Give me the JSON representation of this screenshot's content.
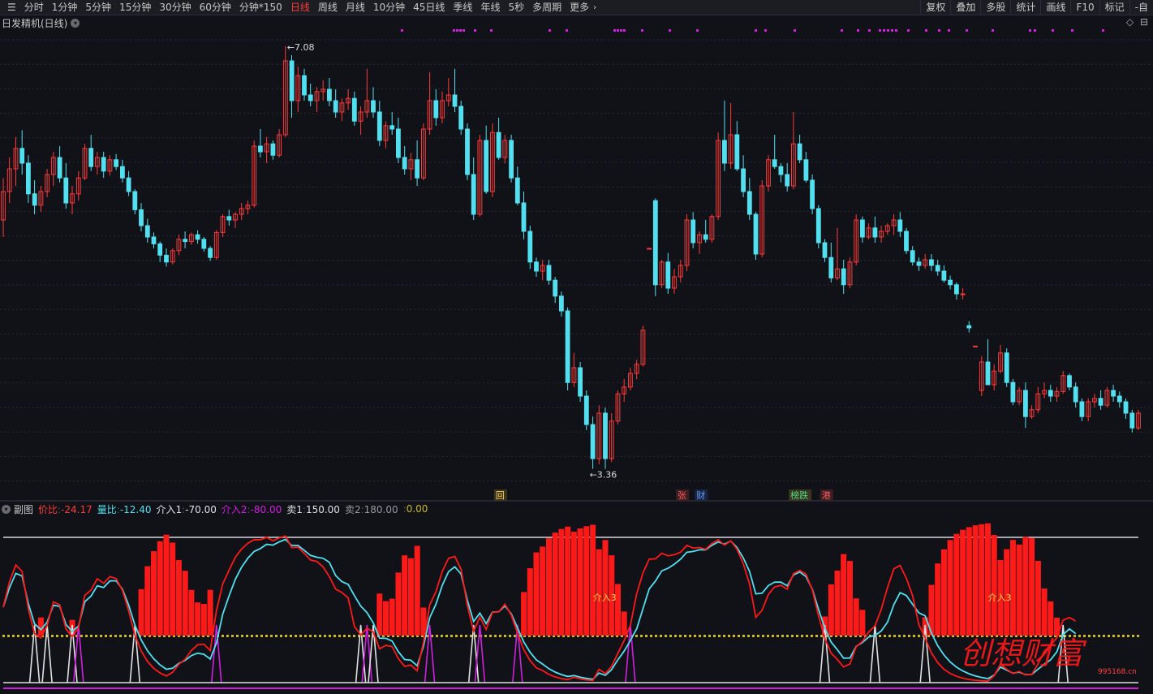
{
  "toolbar": {
    "menu_icon": "☰",
    "period_tabs": [
      {
        "label": "分时",
        "active": false
      },
      {
        "label": "1分钟",
        "active": false
      },
      {
        "label": "5分钟",
        "active": false
      },
      {
        "label": "15分钟",
        "active": false
      },
      {
        "label": "30分钟",
        "active": false
      },
      {
        "label": "60分钟",
        "active": false
      },
      {
        "label": "分钟*150",
        "active": false
      },
      {
        "label": "日线",
        "active": true
      },
      {
        "label": "周线",
        "active": false
      },
      {
        "label": "月线",
        "active": false
      },
      {
        "label": "10分钟",
        "active": false
      },
      {
        "label": "45日线",
        "active": false
      },
      {
        "label": "季线",
        "active": false
      },
      {
        "label": "年线",
        "active": false
      },
      {
        "label": "5秒",
        "active": false
      },
      {
        "label": "多周期",
        "active": false
      },
      {
        "label": "更多",
        "active": false
      }
    ],
    "more_arrow": "›",
    "right_buttons": [
      "复权",
      "叠加",
      "多股",
      "统计",
      "画线",
      "F10",
      "标记",
      "-自"
    ]
  },
  "main_chart": {
    "title": "日发精机(日线)",
    "high_label": "7.08",
    "low_label": "3.36",
    "arrow_glyph": "←",
    "top_right_icons": [
      "◇",
      "⊟"
    ],
    "event_markers": [
      {
        "text": "回",
        "color": "#ffd24a",
        "bg": "#3a3320",
        "after_bar": 78
      },
      {
        "text": "张",
        "color": "#ff5b5b",
        "bg": "#3a1e22",
        "after_bar": 107
      },
      {
        "text": "财",
        "color": "#5aa0ff",
        "bg": "#1c2440",
        "after_bar": 110
      },
      {
        "text": "榜跌",
        "color": "#4ade80",
        "bg": "#3a3320",
        "after_bar": 125
      },
      {
        "text": "港",
        "color": "#ff5b5b",
        "bg": "#3a1e22",
        "after_bar": 130
      }
    ],
    "colors": {
      "up": "#ff3b3b",
      "down": "#52e0f0",
      "grid": "#2a2b33",
      "dot": "#d020e0"
    }
  },
  "sub_chart": {
    "name": "副图",
    "legend": [
      {
        "label": "价比",
        "value": "-24.17",
        "color": "#ff3b3b"
      },
      {
        "label": "量比",
        "value": "-12.40",
        "color": "#52e0f0"
      },
      {
        "label": "介入1",
        "value": "-70.00",
        "color": "#e0e0e0"
      },
      {
        "label": "介入2",
        "value": "-80.00",
        "color": "#d020e0"
      },
      {
        "label": "卖1",
        "value": "150.00",
        "color": "#e0e0e0"
      },
      {
        "label": "卖2",
        "value": "180.00",
        "color": "#9a9a9a"
      },
      {
        "label": "",
        "value": "0.00",
        "color": "#c8b830"
      }
    ],
    "signal_labels": [
      "介入3",
      "介入3"
    ],
    "watermark_brand": "创想财富",
    "watermark_url": "995168.cn"
  },
  "chart_data": {
    "type": "candlestick",
    "y_range": [
      3.2,
      7.2
    ],
    "candles": [
      [
        5.55,
        5.92,
        5.4,
        5.8
      ],
      [
        5.8,
        6.1,
        5.7,
        6.0
      ],
      [
        6.0,
        6.28,
        5.85,
        6.18
      ],
      [
        6.18,
        6.34,
        5.95,
        6.05
      ],
      [
        6.05,
        6.12,
        5.7,
        5.78
      ],
      [
        5.78,
        5.9,
        5.6,
        5.68
      ],
      [
        5.68,
        5.85,
        5.62,
        5.8
      ],
      [
        5.8,
        6.0,
        5.75,
        5.95
      ],
      [
        5.95,
        6.15,
        5.85,
        6.1
      ],
      [
        6.1,
        6.2,
        5.88,
        5.92
      ],
      [
        5.92,
        6.05,
        5.65,
        5.7
      ],
      [
        5.7,
        5.85,
        5.6,
        5.78
      ],
      [
        5.78,
        5.98,
        5.72,
        5.92
      ],
      [
        5.92,
        6.22,
        5.9,
        6.18
      ],
      [
        6.18,
        6.3,
        5.98,
        6.02
      ],
      [
        6.02,
        6.15,
        5.95,
        6.1
      ],
      [
        6.1,
        6.15,
        5.92,
        5.98
      ],
      [
        5.98,
        6.12,
        5.94,
        6.08
      ],
      [
        6.08,
        6.13,
        5.99,
        6.02
      ],
      [
        6.02,
        6.08,
        5.88,
        5.92
      ],
      [
        5.92,
        5.98,
        5.76,
        5.8
      ],
      [
        5.8,
        5.82,
        5.6,
        5.64
      ],
      [
        5.64,
        5.7,
        5.45,
        5.5
      ],
      [
        5.5,
        5.56,
        5.35,
        5.4
      ],
      [
        5.4,
        5.44,
        5.3,
        5.34
      ],
      [
        5.34,
        5.36,
        5.18,
        5.24
      ],
      [
        5.24,
        5.3,
        5.14,
        5.18
      ],
      [
        5.18,
        5.3,
        5.16,
        5.28
      ],
      [
        5.28,
        5.42,
        5.24,
        5.38
      ],
      [
        5.38,
        5.45,
        5.3,
        5.36
      ],
      [
        5.36,
        5.44,
        5.33,
        5.42
      ],
      [
        5.42,
        5.46,
        5.34,
        5.38
      ],
      [
        5.38,
        5.4,
        5.27,
        5.3
      ],
      [
        5.3,
        5.32,
        5.19,
        5.22
      ],
      [
        5.22,
        5.46,
        5.2,
        5.44
      ],
      [
        5.44,
        5.6,
        5.4,
        5.58
      ],
      [
        5.58,
        5.64,
        5.5,
        5.55
      ],
      [
        5.55,
        5.62,
        5.48,
        5.6
      ],
      [
        5.6,
        5.7,
        5.55,
        5.65
      ],
      [
        5.65,
        5.72,
        5.6,
        5.68
      ],
      [
        5.68,
        6.25,
        5.66,
        6.2
      ],
      [
        6.2,
        6.35,
        6.1,
        6.15
      ],
      [
        6.15,
        6.28,
        6.05,
        6.22
      ],
      [
        6.22,
        6.25,
        6.08,
        6.12
      ],
      [
        6.12,
        6.35,
        6.1,
        6.3
      ],
      [
        6.3,
        7.08,
        6.28,
        6.95
      ],
      [
        6.95,
        7.0,
        6.45,
        6.6
      ],
      [
        6.6,
        6.9,
        6.5,
        6.82
      ],
      [
        6.82,
        6.88,
        6.6,
        6.65
      ],
      [
        6.65,
        6.75,
        6.55,
        6.6
      ],
      [
        6.6,
        6.72,
        6.5,
        6.68
      ],
      [
        6.68,
        6.78,
        6.6,
        6.7
      ],
      [
        6.7,
        6.8,
        6.55,
        6.6
      ],
      [
        6.6,
        6.7,
        6.45,
        6.5
      ],
      [
        6.5,
        6.62,
        6.42,
        6.58
      ],
      [
        6.58,
        6.7,
        6.52,
        6.62
      ],
      [
        6.62,
        6.68,
        6.38,
        6.42
      ],
      [
        6.42,
        6.55,
        6.3,
        6.5
      ],
      [
        6.5,
        6.88,
        6.45,
        6.6
      ],
      [
        6.6,
        6.72,
        6.45,
        6.5
      ],
      [
        6.5,
        6.6,
        6.2,
        6.25
      ],
      [
        6.25,
        6.42,
        6.18,
        6.38
      ],
      [
        6.38,
        6.5,
        6.3,
        6.35
      ],
      [
        6.35,
        6.45,
        6.05,
        6.1
      ],
      [
        6.1,
        6.2,
        5.95,
        6.0
      ],
      [
        6.0,
        6.14,
        5.9,
        6.08
      ],
      [
        6.08,
        6.25,
        5.85,
        5.92
      ],
      [
        5.92,
        6.4,
        5.9,
        6.35
      ],
      [
        6.35,
        6.85,
        6.3,
        6.6
      ],
      [
        6.6,
        6.7,
        6.38,
        6.45
      ],
      [
        6.45,
        6.68,
        6.4,
        6.6
      ],
      [
        6.6,
        6.8,
        6.55,
        6.65
      ],
      [
        6.65,
        6.88,
        6.5,
        6.55
      ],
      [
        6.55,
        6.6,
        6.3,
        6.35
      ],
      [
        6.35,
        6.4,
        5.9,
        5.95
      ],
      [
        5.95,
        6.1,
        5.55,
        5.6
      ],
      [
        5.6,
        6.3,
        5.58,
        6.25
      ],
      [
        6.25,
        6.38,
        5.78,
        5.8
      ],
      [
        5.8,
        6.4,
        5.75,
        6.32
      ],
      [
        6.32,
        6.45,
        6.08,
        6.1
      ],
      [
        6.1,
        6.3,
        6.05,
        6.25
      ],
      [
        6.25,
        6.3,
        5.88,
        5.92
      ],
      [
        5.92,
        6.02,
        5.68,
        5.7
      ],
      [
        5.7,
        5.8,
        5.38,
        5.45
      ],
      [
        5.45,
        5.5,
        5.12,
        5.18
      ],
      [
        5.18,
        5.22,
        5.05,
        5.1
      ],
      [
        5.1,
        5.2,
        5.02,
        5.15
      ],
      [
        5.15,
        5.2,
        4.98,
        5.02
      ],
      [
        5.02,
        5.05,
        4.82,
        4.88
      ],
      [
        4.88,
        4.92,
        4.7,
        4.75
      ],
      [
        4.75,
        4.78,
        4.05,
        4.12
      ],
      [
        4.12,
        4.38,
        4.08,
        4.25
      ],
      [
        4.25,
        4.3,
        3.95,
        4.0
      ],
      [
        4.0,
        4.05,
        3.7,
        3.75
      ],
      [
        3.75,
        3.82,
        3.36,
        3.45
      ],
      [
        3.45,
        3.92,
        3.4,
        3.85
      ],
      [
        3.85,
        3.9,
        3.36,
        3.45
      ],
      [
        3.45,
        3.85,
        3.42,
        3.78
      ],
      [
        3.78,
        4.05,
        3.75,
        4.02
      ],
      [
        4.02,
        4.15,
        3.95,
        4.08
      ],
      [
        4.08,
        4.25,
        4.05,
        4.2
      ],
      [
        4.2,
        4.32,
        4.15,
        4.28
      ],
      [
        4.28,
        4.62,
        4.26,
        4.58
      ],
      [
        5.3,
        5.3,
        5.3,
        5.3
      ],
      [
        5.72,
        5.74,
        4.88,
        4.98
      ],
      [
        4.98,
        5.2,
        4.95,
        5.18
      ],
      [
        5.18,
        5.26,
        4.9,
        4.95
      ],
      [
        4.95,
        5.12,
        4.9,
        5.05
      ],
      [
        5.05,
        5.2,
        5.0,
        5.15
      ],
      [
        5.15,
        5.6,
        5.1,
        5.55
      ],
      [
        5.55,
        5.62,
        5.3,
        5.35
      ],
      [
        5.35,
        5.45,
        5.25,
        5.42
      ],
      [
        5.42,
        5.55,
        5.35,
        5.38
      ],
      [
        5.38,
        5.6,
        5.35,
        5.58
      ],
      [
        5.58,
        6.32,
        5.55,
        6.25
      ],
      [
        6.25,
        6.6,
        5.98,
        6.05
      ],
      [
        6.05,
        6.58,
        6.0,
        6.3
      ],
      [
        6.3,
        6.42,
        5.98,
        6.0
      ],
      [
        6.0,
        6.12,
        5.75,
        5.8
      ],
      [
        5.8,
        5.92,
        5.55,
        5.6
      ],
      [
        5.6,
        5.62,
        5.2,
        5.25
      ],
      [
        5.25,
        5.9,
        5.22,
        5.85
      ],
      [
        5.85,
        6.12,
        5.8,
        6.08
      ],
      [
        6.08,
        6.3,
        6.0,
        6.02
      ],
      [
        6.02,
        6.05,
        5.88,
        5.95
      ],
      [
        5.95,
        6.05,
        5.8,
        5.85
      ],
      [
        5.85,
        6.5,
        5.82,
        6.22
      ],
      [
        6.22,
        6.3,
        6.05,
        6.08
      ],
      [
        6.08,
        6.15,
        5.88,
        5.9
      ],
      [
        5.9,
        5.95,
        5.6,
        5.65
      ],
      [
        5.65,
        5.68,
        5.3,
        5.35
      ],
      [
        5.35,
        5.38,
        5.18,
        5.22
      ],
      [
        5.22,
        5.35,
        5.0,
        5.04
      ],
      [
        5.04,
        5.48,
        5.02,
        5.12
      ],
      [
        5.12,
        5.2,
        4.9,
        4.98
      ],
      [
        4.98,
        5.22,
        4.95,
        5.18
      ],
      [
        5.18,
        5.6,
        5.15,
        5.55
      ],
      [
        5.55,
        5.58,
        5.35,
        5.4
      ],
      [
        5.4,
        5.52,
        5.38,
        5.48
      ],
      [
        5.48,
        5.58,
        5.35,
        5.4
      ],
      [
        5.4,
        5.5,
        5.35,
        5.45
      ],
      [
        5.45,
        5.52,
        5.42,
        5.5
      ],
      [
        5.5,
        5.6,
        5.42,
        5.55
      ],
      [
        5.55,
        5.62,
        5.4,
        5.45
      ],
      [
        5.45,
        5.48,
        5.25,
        5.28
      ],
      [
        5.28,
        5.32,
        5.15,
        5.18
      ],
      [
        5.18,
        5.22,
        5.1,
        5.15
      ],
      [
        5.15,
        5.25,
        5.12,
        5.2
      ],
      [
        5.2,
        5.25,
        5.1,
        5.15
      ],
      [
        5.15,
        5.2,
        5.06,
        5.1
      ],
      [
        5.1,
        5.15,
        5.0,
        5.02
      ],
      [
        5.02,
        5.06,
        4.94,
        4.98
      ],
      [
        4.98,
        5.0,
        4.85,
        4.9
      ],
      [
        4.9,
        4.95,
        4.85,
        4.9
      ],
      [
        4.62,
        4.66,
        4.56,
        4.6
      ],
      [
        4.44,
        4.44,
        4.44,
        4.44
      ],
      [
        4.05,
        4.35,
        4.0,
        4.3
      ],
      [
        4.3,
        4.5,
        4.22,
        4.1
      ],
      [
        4.1,
        4.28,
        4.05,
        4.22
      ],
      [
        4.22,
        4.45,
        4.2,
        4.38
      ],
      [
        4.38,
        4.42,
        4.08,
        4.12
      ],
      [
        4.12,
        4.15,
        3.92,
        3.95
      ],
      [
        3.95,
        4.08,
        3.92,
        4.05
      ],
      [
        4.05,
        4.12,
        3.72,
        3.82
      ],
      [
        3.82,
        3.92,
        3.8,
        3.88
      ],
      [
        3.88,
        4.08,
        3.85,
        4.02
      ],
      [
        4.02,
        4.12,
        3.98,
        4.05
      ],
      [
        4.05,
        4.1,
        3.95,
        4.0
      ],
      [
        4.0,
        4.08,
        3.95,
        4.04
      ],
      [
        4.04,
        4.22,
        4.02,
        4.18
      ],
      [
        4.18,
        4.2,
        4.05,
        4.08
      ],
      [
        4.08,
        4.12,
        3.9,
        3.95
      ],
      [
        3.95,
        3.98,
        3.78,
        3.82
      ],
      [
        3.82,
        3.98,
        3.78,
        3.95
      ],
      [
        3.95,
        4.02,
        3.9,
        3.98
      ],
      [
        3.98,
        4.05,
        3.88,
        3.92
      ],
      [
        3.92,
        4.08,
        3.9,
        4.05
      ],
      [
        4.05,
        4.1,
        3.95,
        4.0
      ],
      [
        4.0,
        4.04,
        3.9,
        3.95
      ],
      [
        3.95,
        3.98,
        3.8,
        3.85
      ],
      [
        3.85,
        3.88,
        3.68,
        3.72
      ],
      [
        3.72,
        3.88,
        3.7,
        3.85
      ]
    ]
  }
}
